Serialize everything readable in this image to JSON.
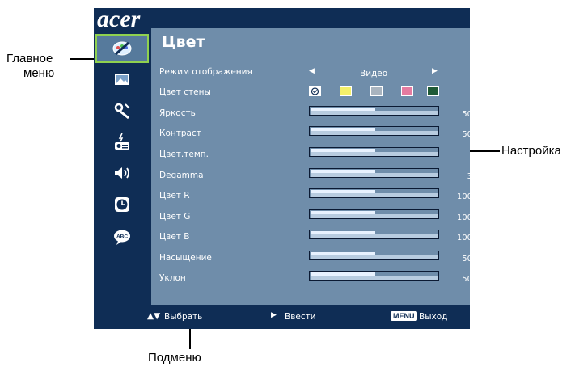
{
  "callouts": {
    "main_menu_line1": "Главное",
    "main_menu_line2": "меню",
    "settings": "Настройка",
    "submenu": "Подменю"
  },
  "osd": {
    "brand": "acer",
    "title": "Цвет",
    "sidebar_icons": [
      "color-icon",
      "image-icon",
      "settings-wrench-icon",
      "projector-icon",
      "speaker-icon",
      "clock-icon",
      "language-abc-icon"
    ],
    "rows": [
      {
        "label": "Режим отображения",
        "value": "Видео",
        "kind": "select"
      },
      {
        "label": "Цвет стены",
        "kind": "swatches"
      },
      {
        "label": "Яркость",
        "value": "50",
        "kind": "slider",
        "level": 0.5
      },
      {
        "label": "Контраст",
        "value": "50",
        "kind": "slider",
        "level": 0.5
      },
      {
        "label": "Цвет.темп.",
        "value": "",
        "kind": "slider",
        "level": 0.5
      },
      {
        "label": "Degamma",
        "value": "3",
        "kind": "slider",
        "level": 0.5
      },
      {
        "label": "Цвет R",
        "value": "100",
        "kind": "slider",
        "level": 0.5
      },
      {
        "label": "Цвет G",
        "value": "100",
        "kind": "slider",
        "level": 0.5
      },
      {
        "label": "Цвет B",
        "value": "100",
        "kind": "slider",
        "level": 0.5
      },
      {
        "label": "Насыщение",
        "value": "50",
        "kind": "slider",
        "level": 0.5
      },
      {
        "label": "Уклон",
        "value": "50",
        "kind": "slider",
        "level": 0.5
      }
    ],
    "swatch_colors": [
      "#ffffff",
      "#f4f06a",
      "#a9b4bf",
      "#e57ba0",
      "#1f5a36"
    ],
    "footer": {
      "select": "Выбрать",
      "enter": "Ввести",
      "menu_key": "MENU",
      "exit": "Выход"
    }
  }
}
